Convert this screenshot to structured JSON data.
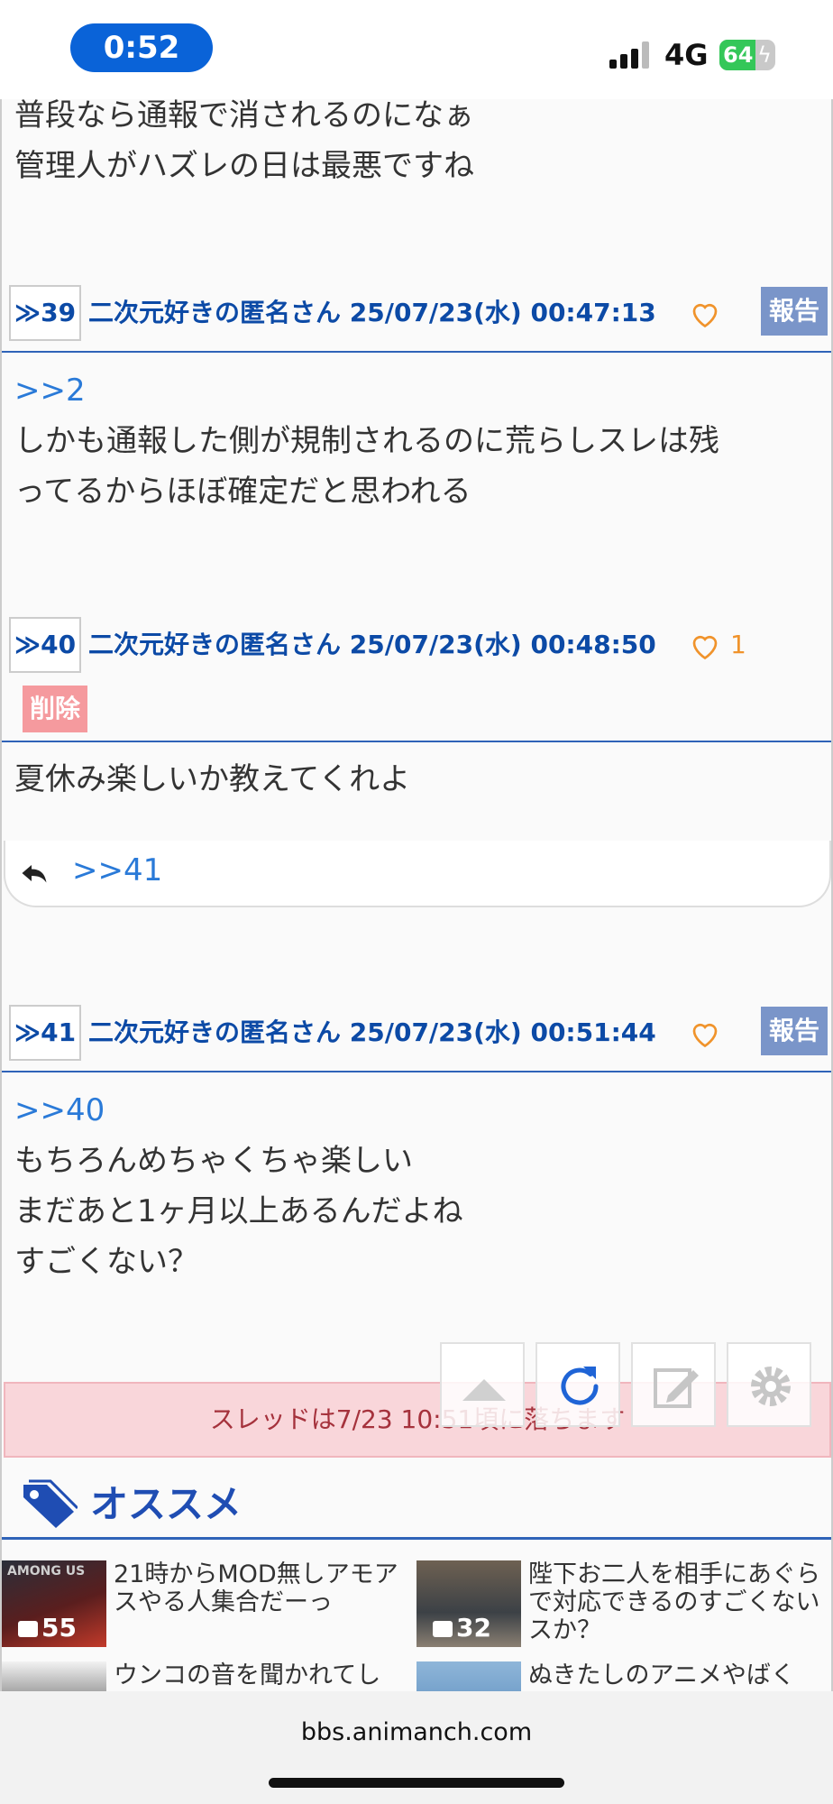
{
  "status_bar": {
    "time": "0:52",
    "network": "4G",
    "battery_level": "64",
    "battery_fraction": 0.64
  },
  "posts": [
    {
      "id": "post-38",
      "body_lines": [
        "普段なら通報で消されるのになぁ",
        "管理人がハズレの日は最悪ですね"
      ]
    },
    {
      "id": "post-39",
      "number": "≫39",
      "author": "二次元好きの匿名さん",
      "date": "25/07/23(水) 00:47:13",
      "report_label": "報告",
      "anchor": ">>2",
      "body_lines": [
        "しかも通報した側が規制されるのに荒らしスレは残",
        "ってるからほぼ確定だと思われる"
      ]
    },
    {
      "id": "post-40",
      "number": "≫40",
      "author": "二次元好きの匿名さん",
      "date": "25/07/23(水) 00:48:50",
      "like_count": "1",
      "delete_label": "削除",
      "body_lines": [
        "夏休み楽しいか教えてくれよ"
      ],
      "reply_link": ">>41"
    },
    {
      "id": "post-41",
      "number": "≫41",
      "author": "二次元好きの匿名さん",
      "date": "25/07/23(水) 00:51:44",
      "report_label": "報告",
      "anchor": ">>40",
      "body_lines": [
        "もちろんめちゃくちゃ楽しい",
        "まだあと1ヶ月以上あるんだよね",
        "すごくない？"
      ]
    }
  ],
  "notice": "スレッドは7/23 10:51頃に落ちます",
  "floating_buttons": [
    "scroll-top-icon",
    "reload-icon",
    "edit-icon",
    "gear-icon"
  ],
  "recommend": {
    "title": "オススメ",
    "items": [
      {
        "count": "55",
        "text": "21時からMOD無しアモアスやる人集合だーっ",
        "thumb_text": "AMONG US"
      },
      {
        "count": "32",
        "text": "陛下お二人を相手にあぐらで対応できるのすごくないスか？"
      },
      {
        "count": "",
        "text": "ウンコの音を聞かれてし"
      },
      {
        "count": "",
        "text": "ぬきたしのアニメやばく"
      }
    ]
  },
  "browser": {
    "url": "bbs.animanch.com"
  },
  "colors": {
    "accent": "#2f63b8",
    "link": "#2a7ad8",
    "heart": "#f0932b",
    "report": "#7a95c9",
    "delete": "#f59a9e"
  }
}
